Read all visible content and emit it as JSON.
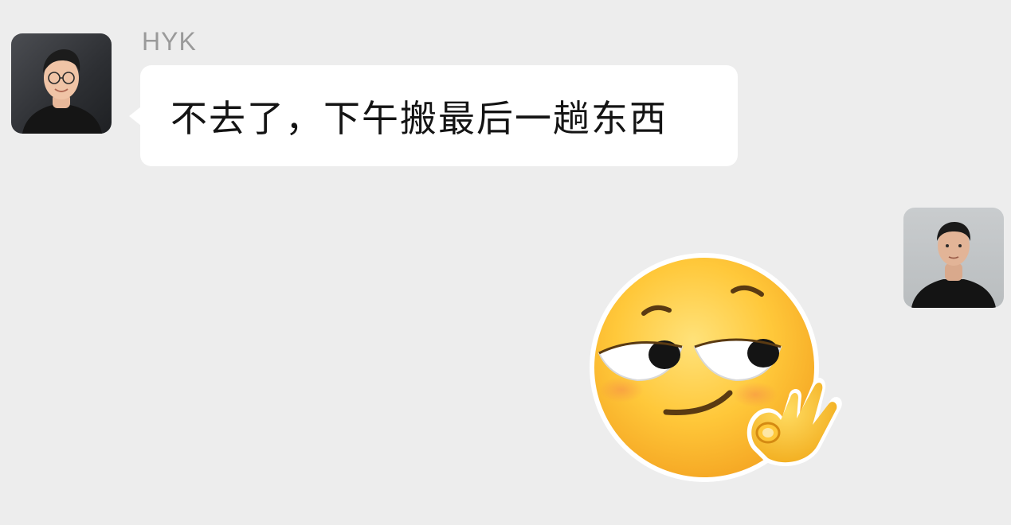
{
  "conversation": {
    "incoming": {
      "sender_name": "HYK",
      "message_text": "不去了，下午搬最后一趟东西",
      "avatar_icon": "person-photo-avatar"
    },
    "outgoing": {
      "avatar_icon": "person-photo-avatar",
      "sticker_icon": "smirk-ok-hand-emoji"
    }
  },
  "colors": {
    "background": "#ededed",
    "bubble": "#ffffff",
    "sender_name": "#9a9a9a",
    "message_text": "#141414"
  }
}
